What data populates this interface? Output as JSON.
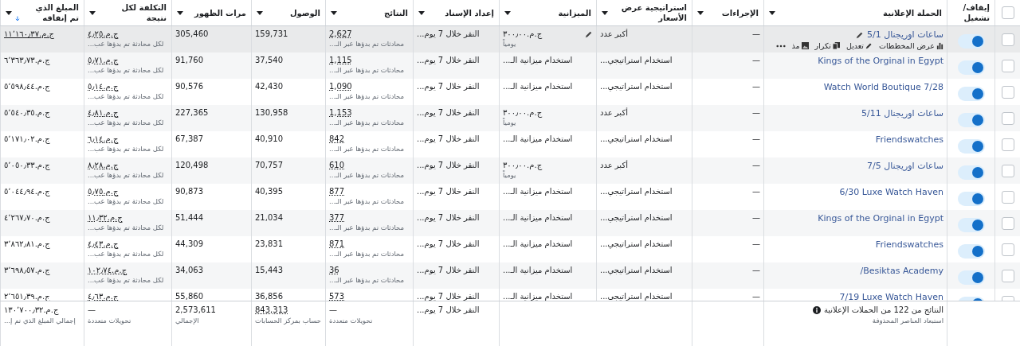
{
  "select_all": {
    "checked": false
  },
  "columns": [
    {
      "label": "إيقاف/ تشغيل",
      "menu": false
    },
    {
      "label": "الحملة الإعلانية",
      "menu": true
    },
    {
      "label": "الإجراءات",
      "menu": true
    },
    {
      "label": "استراتيجية عرض الأسعار",
      "menu": true
    },
    {
      "label": "الميزانية",
      "menu": true
    },
    {
      "label": "إعداد الإسناد",
      "menu": true
    },
    {
      "label": "النتائج",
      "menu": true
    },
    {
      "label": "الوصول",
      "menu": true
    },
    {
      "label": "مرات الظهور",
      "menu": true
    },
    {
      "label": "التكلفة لكل نتيجة",
      "menu": true
    },
    {
      "label": "المبلغ الذي تم إنفاقه",
      "menu": true,
      "sorted_descending": true
    }
  ],
  "rows": [
    {
      "checked": false,
      "on": true,
      "hovered": true,
      "campaign": "ساعات اوريجنال 5/1",
      "quick_actions": [
        {
          "kind": "chart",
          "label": "عرض المخططات"
        },
        {
          "kind": "edit",
          "label": "تعديل"
        },
        {
          "kind": "duplicate",
          "label": "تكرار"
        },
        {
          "kind": "image",
          "label": "مذ"
        },
        {
          "kind": "more"
        }
      ],
      "actions": "—",
      "bid_strategy": "أكبر عدد",
      "budget": "ج.م.٣٠٠٫٠٠",
      "budget_period": "يومياً",
      "attribution": "النقر خلال 7 يوم...",
      "results": "2,627",
      "results_note": "محادثات تم بدؤها عبر الـ...",
      "reach": "159,731",
      "impressions": "305,460",
      "cost_per_result": "ج.م.٤٫٢٥",
      "cost_note": "لكل محادثة تم بدؤها عب...",
      "amount_spent": "ج.م.١١٬١٦٠٫٣٧"
    },
    {
      "checked": false,
      "on": true,
      "hovered": false,
      "campaign": "Kings of the Orginal in Egypt",
      "actions": "—",
      "bid_strategy": "استخدام استراتيجي...",
      "budget": "استخدام ميزانية الـ...",
      "attribution": "النقر خلال 7 يوم...",
      "results": "1,115",
      "results_note": "محادثات تم بدؤها عبر الـ...",
      "reach": "37,540",
      "impressions": "91,760",
      "cost_per_result": "ج.م.٥٫٧١",
      "cost_note": "لكل محادثة تم بدؤها عب...",
      "amount_spent": "ج.م.٦٬٣٦٣٫٧٣"
    },
    {
      "checked": false,
      "on": true,
      "hovered": false,
      "campaign": "Watch World Boutique 7/28",
      "actions": "—",
      "bid_strategy": "استخدام استراتيجي...",
      "budget": "استخدام ميزانية الـ...",
      "attribution": "النقر خلال 7 يوم...",
      "results": "1,090",
      "results_note": "محادثات تم بدؤها عبر الـ...",
      "reach": "42,430",
      "impressions": "90,576",
      "cost_per_result": "ج.م.٥٫١٤",
      "cost_note": "لكل محادثة تم بدؤها عب...",
      "amount_spent": "ج.م.٥٬٥٩٨٫٤٤"
    },
    {
      "checked": false,
      "on": true,
      "hovered": false,
      "campaign": "ساعات اوريجنال 5/11",
      "actions": "—",
      "bid_strategy": "أكبر عدد",
      "budget": "ج.م.٣٠٠٫٠٠",
      "budget_period": "يومياً",
      "attribution": "النقر خلال 7 يوم...",
      "results": "1,153",
      "results_note": "محادثات تم بدؤها عبر الـ...",
      "reach": "130,958",
      "impressions": "227,365",
      "cost_per_result": "ج.م.٤٫٨١",
      "cost_note": "لكل محادثة تم بدؤها عب...",
      "amount_spent": "ج.م.٥٬٥٤٠٫٣٥"
    },
    {
      "checked": false,
      "on": true,
      "hovered": false,
      "campaign": "Friendswatches",
      "actions": "—",
      "bid_strategy": "استخدام استراتيجي...",
      "budget": "استخدام ميزانية الـ...",
      "attribution": "النقر خلال 7 يوم...",
      "results": "842",
      "results_note": "محادثات تم بدؤها عبر الـ...",
      "reach": "40,910",
      "impressions": "67,387",
      "cost_per_result": "ج.م.٦٫١٤",
      "cost_note": "لكل محادثة تم بدؤها عب...",
      "amount_spent": "ج.م.٥٬١٧١٫٠٢"
    },
    {
      "checked": false,
      "on": true,
      "hovered": false,
      "campaign": "ساعات اوريجنال 7/5",
      "actions": "—",
      "bid_strategy": "أكبر عدد",
      "budget": "ج.م.٣٠٠٫٠٠",
      "budget_period": "يومياً",
      "attribution": "النقر خلال 7 يوم...",
      "results": "610",
      "results_note": "محادثات تم بدؤها عبر الـ...",
      "reach": "70,757",
      "impressions": "120,498",
      "cost_per_result": "ج.م.٨٫٢٨",
      "cost_note": "لكل محادثة تم بدؤها عب...",
      "amount_spent": "ج.م.٥٬٠٥٠٫٣٣"
    },
    {
      "checked": false,
      "on": true,
      "hovered": false,
      "campaign": "6/30 Luxe Watch Haven",
      "actions": "—",
      "bid_strategy": "استخدام استراتيجي...",
      "budget": "استخدام ميزانية الـ...",
      "attribution": "النقر خلال 7 يوم...",
      "results": "877",
      "results_note": "محادثات تم بدؤها عبر الـ...",
      "reach": "40,395",
      "impressions": "90,873",
      "cost_per_result": "ج.م.٥٫٧٥",
      "cost_note": "لكل محادثة تم بدؤها عب...",
      "amount_spent": "ج.م.٥٬٠٤٤٫٩٤"
    },
    {
      "checked": false,
      "on": true,
      "hovered": false,
      "campaign": "Kings of the Orginal in Egypt",
      "actions": "—",
      "bid_strategy": "استخدام استراتيجي...",
      "budget": "استخدام ميزانية الـ...",
      "attribution": "النقر خلال 7 يوم...",
      "results": "377",
      "results_note": "محادثات تم بدؤها عبر الـ...",
      "reach": "21,034",
      "impressions": "51,444",
      "cost_per_result": "ج.م.١١٫٣٢",
      "cost_note": "لكل محادثة تم بدؤها عب...",
      "amount_spent": "ج.م.٤٬٢٦٧٫٧٠"
    },
    {
      "checked": false,
      "on": true,
      "hovered": false,
      "campaign": "Friendswatches",
      "actions": "—",
      "bid_strategy": "استخدام استراتيجي...",
      "budget": "استخدام ميزانية الـ...",
      "attribution": "النقر خلال 7 يوم...",
      "results": "871",
      "results_note": "محادثات تم بدؤها عبر الـ...",
      "reach": "23,831",
      "impressions": "44,309",
      "cost_per_result": "ج.م.٤٫٤٣",
      "cost_note": "لكل محادثة تم بدؤها عب...",
      "amount_spent": "ج.م.٣٬٨٦٢٫٨١"
    },
    {
      "checked": false,
      "on": true,
      "hovered": false,
      "campaign": "/Besiktas Academy",
      "actions": "—",
      "bid_strategy": "استخدام استراتيجي...",
      "budget": "استخدام ميزانية الـ...",
      "attribution": "النقر خلال 7 يوم...",
      "results": "36",
      "results_note": "محادثات تم بدؤها عبر الـ...",
      "reach": "15,443",
      "impressions": "34,063",
      "cost_per_result": "ج.م.١٠٢٫٧٤",
      "cost_note": "لكل محادثة تم بدؤها عب...",
      "amount_spent": "ج.م.٣٬٦٩٨٫٥٧"
    },
    {
      "checked": false,
      "on": true,
      "hovered": false,
      "campaign": "7/19 Luxe Watch Haven",
      "actions": "—",
      "bid_strategy": "استخدام استراتيجي...",
      "budget": "استخدام ميزانية الـ...",
      "attribution": "النقر خلال 7 يوم...",
      "results": "573",
      "reach": "36,856",
      "impressions": "55,860",
      "cost_per_result": "ج.م.٤٫٦٣",
      "amount_spent": "ج.م.٢٬٦٥١٫٣٩"
    }
  ],
  "totals": {
    "summary": "النتائج من 122 من الحملات الإعلانية",
    "summary_note": "استبعاد العناصر المحذوفة",
    "attribution": "النقر خلال 7 يوم...",
    "results": "—",
    "results_note": "تحويلات متعددة",
    "reach": "843,313",
    "reach_note": "حساب بمركز الحسابات",
    "impressions": "2,573,611",
    "impressions_note": "الإجمالي",
    "cost_per_result": "—",
    "cost_note": "تحويلات متعددة",
    "amount_spent": "ج.م.١٣٠٬٧٠٠٫٣٢",
    "amount_note": "إجمالي المبلغ الذي تم إ..."
  }
}
